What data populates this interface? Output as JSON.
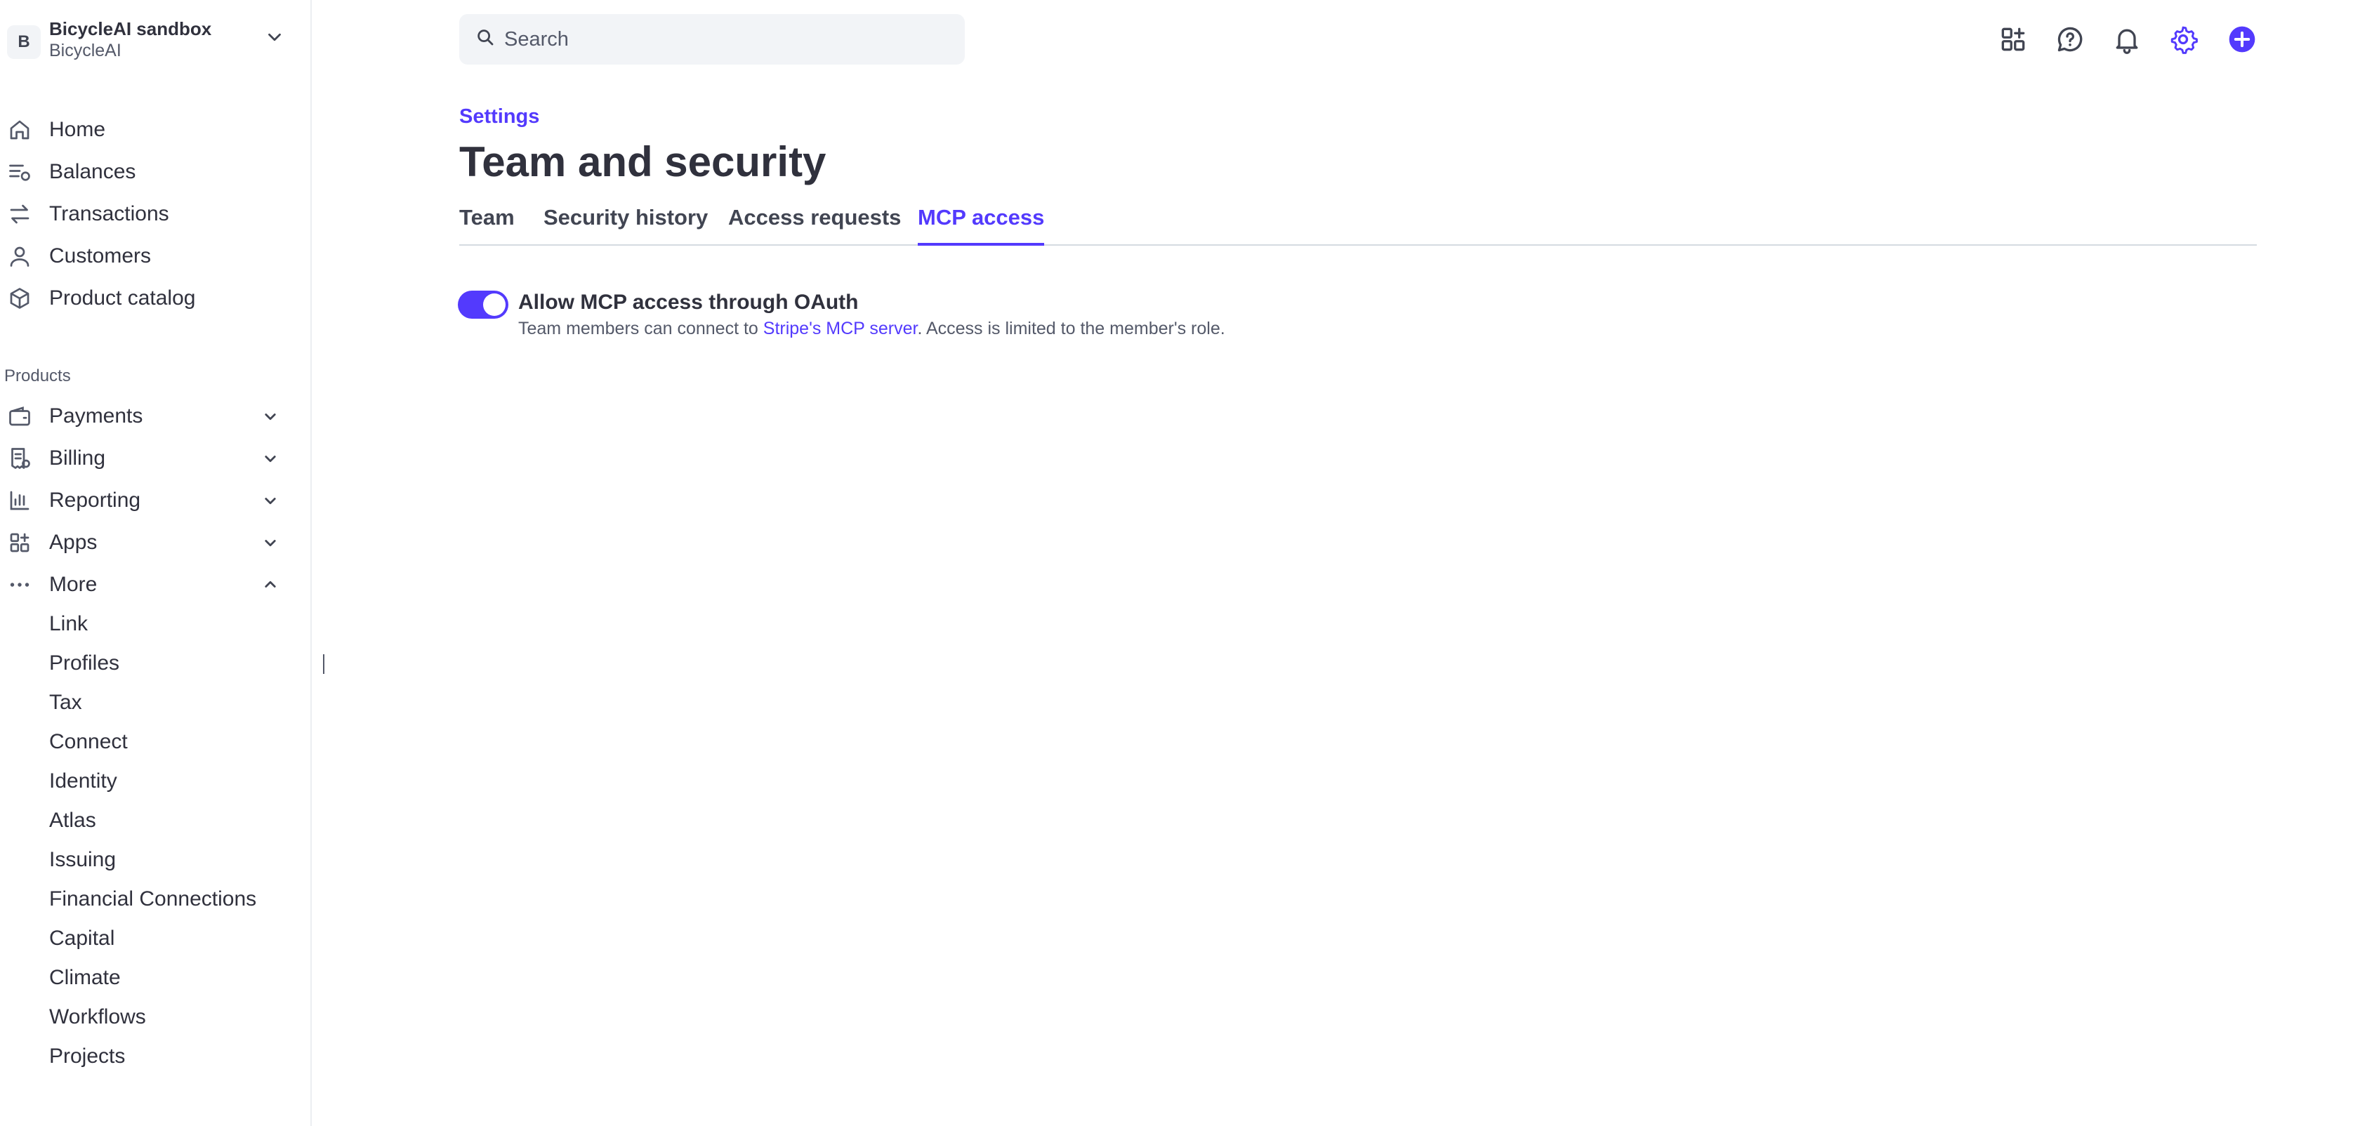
{
  "account": {
    "initial": "B",
    "name": "BicycleAI sandbox",
    "org": "BicycleAI"
  },
  "nav": {
    "primary": [
      {
        "label": "Home",
        "icon": "home-icon"
      },
      {
        "label": "Balances",
        "icon": "balances-icon"
      },
      {
        "label": "Transactions",
        "icon": "transactions-icon"
      },
      {
        "label": "Customers",
        "icon": "customers-icon"
      },
      {
        "label": "Product catalog",
        "icon": "product-catalog-icon"
      }
    ],
    "section_label": "Products",
    "products": [
      {
        "label": "Payments",
        "icon": "wallet-icon"
      },
      {
        "label": "Billing",
        "icon": "billing-icon"
      },
      {
        "label": "Reporting",
        "icon": "reporting-icon"
      },
      {
        "label": "Apps",
        "icon": "apps-icon"
      },
      {
        "label": "More",
        "icon": "more-icon"
      }
    ],
    "more_items": [
      "Link",
      "Profiles",
      "Tax",
      "Connect",
      "Identity",
      "Atlas",
      "Issuing",
      "Financial Connections",
      "Capital",
      "Climate",
      "Workflows",
      "Projects"
    ]
  },
  "search": {
    "placeholder": "Search"
  },
  "topbar_icons": [
    "apps-grid-icon",
    "help-icon",
    "bell-icon",
    "gear-icon",
    "plus-icon"
  ],
  "main": {
    "breadcrumb": "Settings",
    "title": "Team and security",
    "tabs": [
      "Team",
      "Security history",
      "Access requests",
      "MCP access"
    ],
    "active_tab": "MCP access",
    "option": {
      "title": "Allow MCP access through OAuth",
      "desc_before": "Team members can connect to ",
      "desc_link": "Stripe's MCP server",
      "desc_after": ". Access is limited to the member's role.",
      "enabled": true
    }
  },
  "colors": {
    "accent": "#533afd",
    "text": "#30313d",
    "muted": "#545969"
  }
}
